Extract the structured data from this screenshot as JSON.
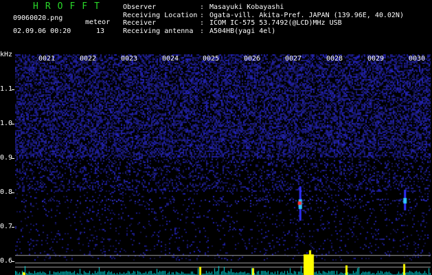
{
  "header": {
    "app_title": "HROFFT",
    "file_name": "09060020.png",
    "meteor_label": "meteor",
    "datetime": "02.09.06 00:20",
    "meteor_count": "13"
  },
  "station_info": {
    "rows": [
      {
        "label": "Observer",
        "sep": ":",
        "value": "Masayuki Kobayashi"
      },
      {
        "label": "Receiving Location",
        "sep": ":",
        "value": "Ogata-vill. Akita-Pref. JAPAN (139.96E, 40.02N)"
      },
      {
        "label": "Receiver",
        "sep": ":",
        "value": "ICOM IC-575 53.7492(@LCD)MHz USB"
      },
      {
        "label": "Receiving antenna",
        "sep": ":",
        "value": "A504HB(yagi 4el)"
      }
    ]
  },
  "spectrogram": {
    "y_unit": "kHz",
    "y_ticks": [
      "1.1",
      "1.0",
      "0.9",
      "0.8",
      "0.7",
      "0.6"
    ],
    "time_ticks": [
      "0021",
      "0022",
      "0023",
      "0024",
      "0025",
      "0026",
      "0027",
      "0028",
      "0029",
      "0030"
    ],
    "colors": {
      "background": "#000000",
      "noise": "#1a1aa0",
      "signal_line": "#3030ff",
      "meteor_core": "#ff3030",
      "meteor_halo": "#30c8ff",
      "power_trace": "#00e0e0",
      "power_peak": "#ffff00",
      "reference_lines": "#a0a0a0"
    },
    "meteor_events": [
      {
        "minute": 27.35,
        "frequency_khz": 0.77,
        "strength": 1.0
      },
      {
        "minute": 29.9,
        "frequency_khz": 0.78,
        "strength": 0.5
      }
    ]
  }
}
